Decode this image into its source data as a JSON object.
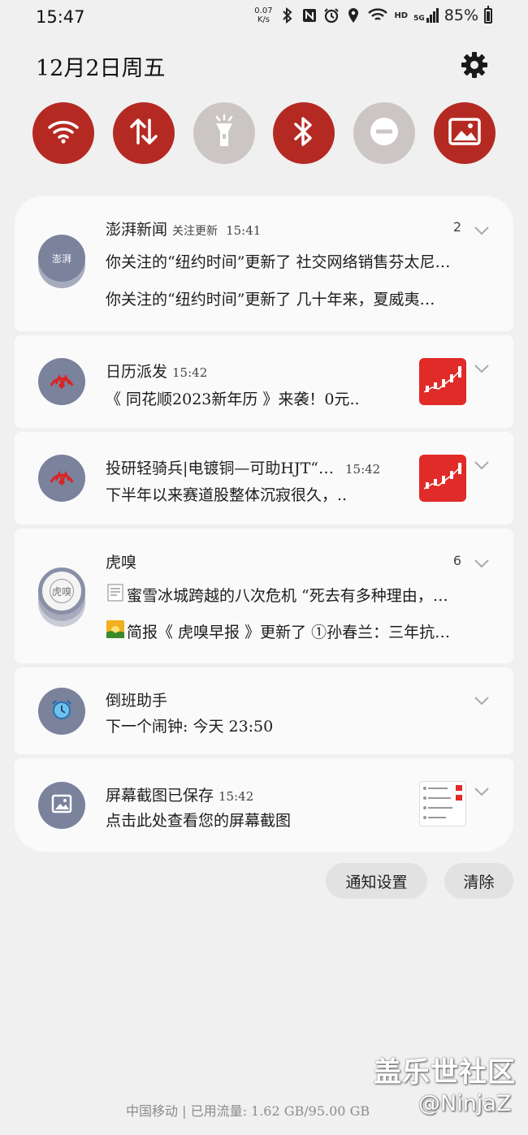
{
  "status_bar": {
    "time": "15:47",
    "net_speed_value": "0.07",
    "net_speed_unit": "K/s",
    "hd_label": "HD",
    "network_label": "5G",
    "battery": "85%",
    "icons": [
      "bluetooth-icon",
      "nfc-icon",
      "alarm-icon",
      "location-icon",
      "wifi-icon",
      "signal-icon",
      "battery-icon"
    ]
  },
  "header": {
    "date": "12月2日周五"
  },
  "quick_toggles": [
    {
      "name": "wifi",
      "active": true
    },
    {
      "name": "mobile-data",
      "active": true
    },
    {
      "name": "flashlight",
      "active": false
    },
    {
      "name": "bluetooth",
      "active": true
    },
    {
      "name": "do-not-disturb",
      "active": false
    },
    {
      "name": "screenshot-gallery",
      "active": true
    }
  ],
  "notifications": [
    {
      "app": "澎湃新闻",
      "icon_text": "澎湃",
      "subtitle": "关注更新",
      "time": "15:41",
      "count": "2",
      "lines": [
        "你关注的“纽约时间”更新了 社交网络销售芬太尼…",
        "你关注的“纽约时间”更新了 几十年来，夏威夷…"
      ]
    },
    {
      "app": "日历派发",
      "time": "15:42",
      "lines": [
        "《 同花顺2023新年历 》来袭！0元.."
      ]
    },
    {
      "app": "投研轻骑兵|电镀铜—可助HJT“…",
      "time": "15:42",
      "lines": [
        "下半年以来赛道股整体沉寂很久，.."
      ]
    },
    {
      "app": "虎嗅",
      "icon_text": "虎嗅",
      "count": "6",
      "lines": [
        "蜜雪冰城跨越的八次危机 “死去有多种理由，…",
        "简报《 虎嗅早报 》更新了 ①孙春兰：三年抗…"
      ]
    },
    {
      "app": "倒班助手",
      "lines": [
        "下一个闹钟: 今天 23:50"
      ]
    },
    {
      "app": "屏幕截图已保存",
      "time": "15:42",
      "lines": [
        "点击此处查看您的屏幕截图"
      ]
    }
  ],
  "actions": {
    "settings_label": "通知设置",
    "clear_label": "清除"
  },
  "footer": {
    "carrier_info": "中国移动 | 已用流量: 1.62 GB/95.00 GB"
  },
  "watermark": {
    "line1": "盖乐世社区",
    "line2": "@NinjaZ"
  },
  "colors": {
    "toggle_on": "#b42a22",
    "toggle_off": "#cbc6c4",
    "app_icon": "#7a829c",
    "thumb_red": "#e02b28"
  }
}
